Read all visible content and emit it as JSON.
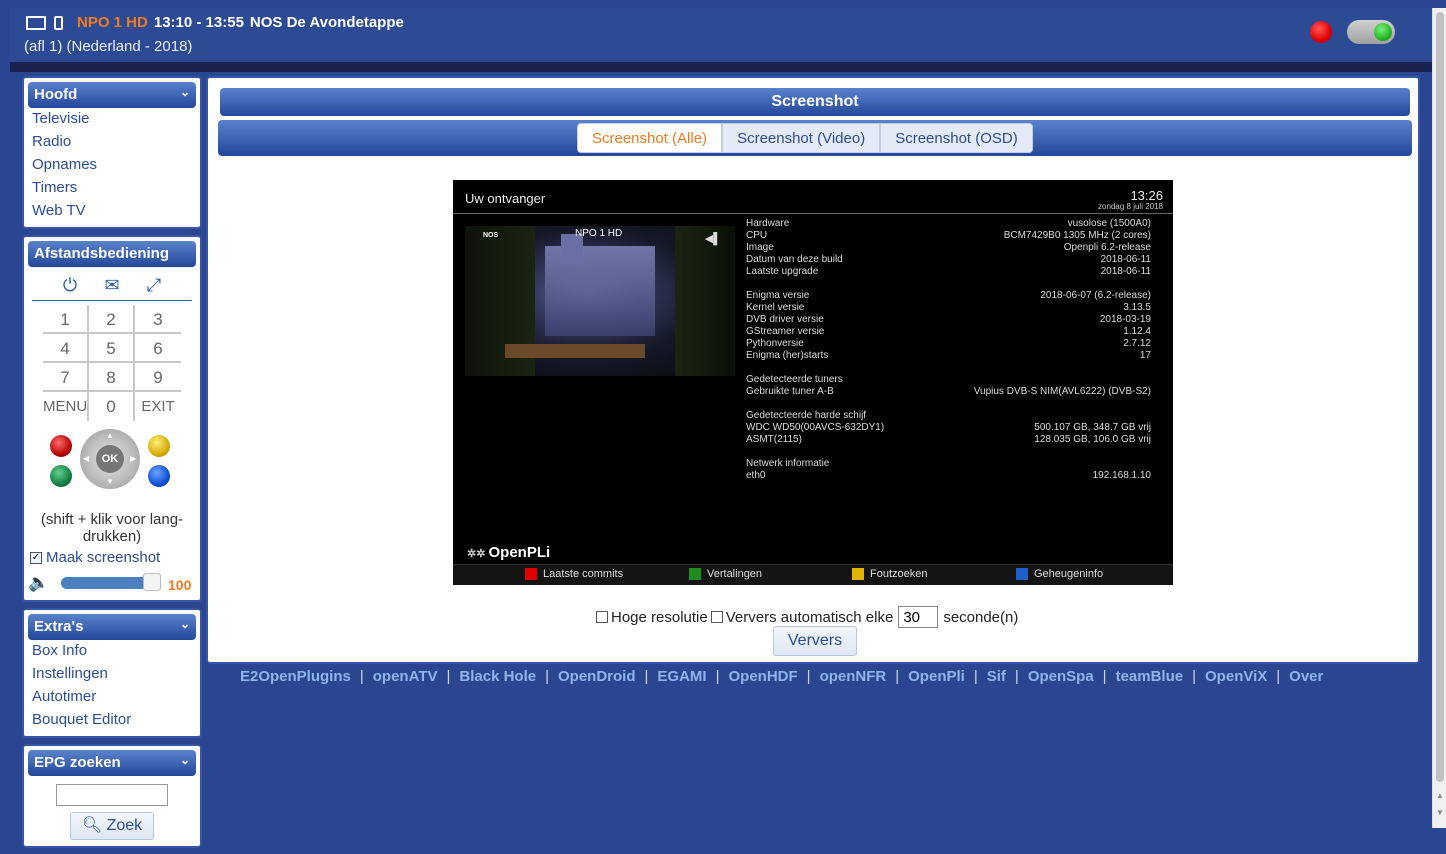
{
  "header": {
    "channel": "NPO 1 HD",
    "time_range": "13:10 - 13:55",
    "program": "NOS De Avondetappe",
    "subtitle": "(afl 1) (Nederland - 2018)"
  },
  "sidebar": {
    "main": {
      "title": "Hoofd",
      "items": [
        "Televisie",
        "Radio",
        "Opnames",
        "Timers",
        "Web TV"
      ]
    },
    "remote": {
      "title": "Afstandsbediening",
      "keys": [
        "1",
        "2",
        "3",
        "4",
        "5",
        "6",
        "7",
        "8",
        "9",
        "MENU",
        "0",
        "EXIT"
      ],
      "ok_label": "OK",
      "hint": "(shift + klik voor lang-drukken)",
      "screenshot_label": "Maak screenshot",
      "screenshot_checked": true,
      "volume_value": "100",
      "volume_level_percent": 100
    },
    "extras": {
      "title": "Extra's",
      "items": [
        "Box Info",
        "Instellingen",
        "Autotimer",
        "Bouquet Editor"
      ]
    },
    "epg": {
      "title": "EPG zoeken",
      "search_value": "",
      "button": "Zoek"
    }
  },
  "main": {
    "title": "Screenshot",
    "tabs": [
      {
        "label": "Screenshot (Alle)",
        "active": true
      },
      {
        "label": "Screenshot (Video)",
        "active": false
      },
      {
        "label": "Screenshot (OSD)",
        "active": false
      }
    ],
    "shot": {
      "title": "Uw ontvanger",
      "clock": "13:26",
      "date": "zondag 8 juli 2018",
      "channel": "NPO 1 HD",
      "logo": "NOS",
      "info": [
        {
          "k": "Hardware",
          "v": "vusolose (1500A0)"
        },
        {
          "k": "CPU",
          "v": "BCM7429B0 1305 MHz (2 cores)"
        },
        {
          "k": "Image",
          "v": "Openpli 6.2-release"
        },
        {
          "k": "Datum van deze build",
          "v": "2018-06-11"
        },
        {
          "k": "Laatste upgrade",
          "v": "2018-06-11"
        },
        {
          "k": "",
          "v": ""
        },
        {
          "k": "Enigma versie",
          "v": "2018-06-07 (6.2-release)"
        },
        {
          "k": "Kernel versie",
          "v": "3.13.5"
        },
        {
          "k": "DVB driver versie",
          "v": "2018-03-19"
        },
        {
          "k": "GStreamer versie",
          "v": "1.12.4"
        },
        {
          "k": "Pythonversie",
          "v": "2.7.12"
        },
        {
          "k": "Enigma (her)starts",
          "v": "17"
        },
        {
          "k": "",
          "v": ""
        },
        {
          "k": "Gedetecteerde tuners",
          "v": ""
        },
        {
          "k": "Gebruikte tuner A-B",
          "v": "Vupius DVB-S NIM(AVL6222) (DVB-S2)"
        },
        {
          "k": "",
          "v": ""
        },
        {
          "k": "Gedetecteerde harde schijf",
          "v": ""
        },
        {
          "k": "WDC WD50(00AVCS-632DY1)",
          "v": "500.107 GB, 348.7 GB vrij"
        },
        {
          "k": "ASMT(2115)",
          "v": "128.035 GB, 106.0 GB vrij"
        },
        {
          "k": "",
          "v": ""
        },
        {
          "k": "Netwerk informatie",
          "v": ""
        },
        {
          "k": "eth0",
          "v": "192.168.1.10"
        }
      ],
      "brand": "OpenPLi",
      "buttons": [
        {
          "label": "Laatste commits",
          "color": "#e00000"
        },
        {
          "label": "Vertalingen",
          "color": "#1e8c1e"
        },
        {
          "label": "Foutzoeken",
          "color": "#e0b400"
        },
        {
          "label": "Geheugeninfo",
          "color": "#1e5fc8"
        }
      ]
    },
    "controls": {
      "high_res_label": "Hoge resolutie",
      "auto_label": "Ververs automatisch elke",
      "interval_value": "30",
      "unit_label": "seconde(n)",
      "refresh_button": "Ververs"
    }
  },
  "footer_links": [
    "E2OpenPlugins",
    "openATV",
    "Black Hole",
    "OpenDroid",
    "EGAMI",
    "OpenHDF",
    "openNFR",
    "OpenPli",
    "Sif",
    "OpenSpa",
    "teamBlue",
    "OpenViX",
    "Over"
  ]
}
